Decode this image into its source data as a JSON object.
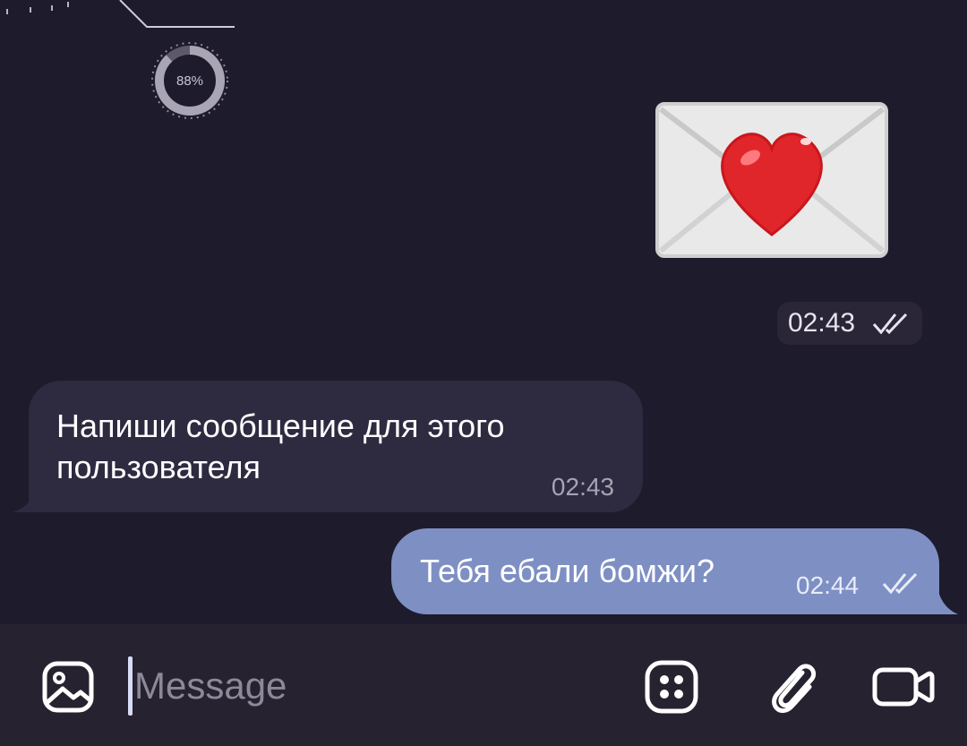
{
  "header_fragment": {
    "progress_label": "88%",
    "progress_value": 0.88
  },
  "messages": [
    {
      "type": "sticker",
      "sticker_name": "envelope-heart-sticker",
      "time": "02:43",
      "status": "read"
    },
    {
      "type": "incoming",
      "text": "Напиши сообщение для этого пользователя",
      "time": "02:43"
    },
    {
      "type": "outgoing",
      "text": "Тебя ебали бомжи?",
      "time": "02:44",
      "status": "read"
    }
  ],
  "input_bar": {
    "placeholder": "Message",
    "value": "",
    "icons": [
      "image-icon",
      "sticker-grid-icon",
      "paperclip-icon",
      "video-camera-icon"
    ]
  },
  "colors": {
    "background": "#1e1b2c",
    "incoming_bubble": "#2e2a40",
    "outgoing_bubble": "#7e8fc4",
    "input_bar": "#26222f"
  }
}
